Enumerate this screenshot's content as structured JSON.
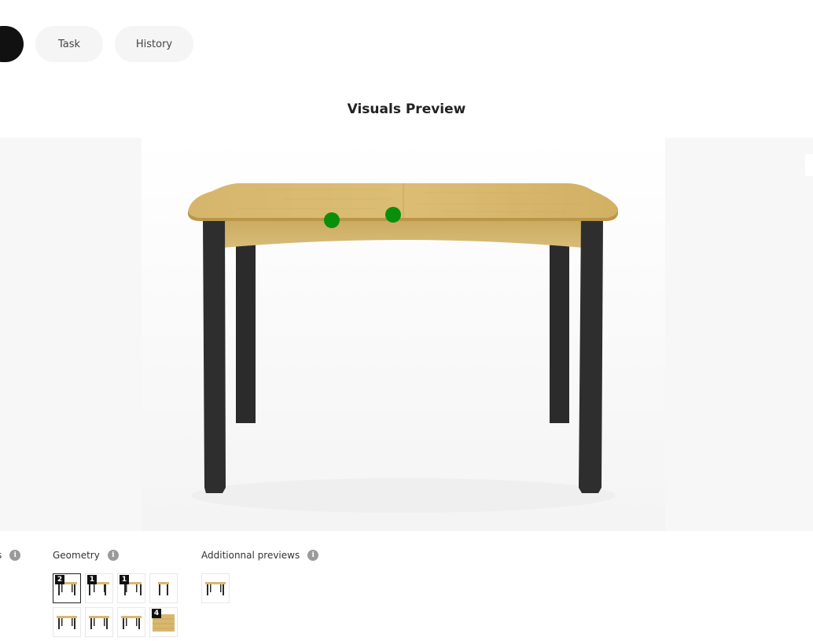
{
  "tabs": [
    {
      "label": "",
      "active": true
    },
    {
      "label": "Task",
      "active": false
    },
    {
      "label": "History",
      "active": false
    }
  ],
  "title": "Visuals Preview",
  "hotspots": [
    {
      "label": "",
      "color": "#0a8f0a"
    },
    {
      "label": "",
      "color": "#0a8f0a"
    }
  ],
  "sections": {
    "cut_label": "s",
    "geometry_label": "Geometry",
    "additional_label": "Additionnal previews",
    "info_icon": "info-icon"
  },
  "geometry_thumbs": [
    {
      "badge": "2",
      "selected": true,
      "view": "front"
    },
    {
      "badge": "1",
      "selected": false,
      "view": "angle-left"
    },
    {
      "badge": "1",
      "selected": false,
      "view": "angle-right"
    },
    {
      "badge": "",
      "selected": false,
      "view": "side"
    },
    {
      "badge": "",
      "selected": false,
      "view": "front"
    },
    {
      "badge": "",
      "selected": false,
      "view": "front"
    },
    {
      "badge": "",
      "selected": false,
      "view": "front"
    },
    {
      "badge": "4",
      "selected": false,
      "view": "wood-texture"
    }
  ],
  "additional_thumbs": [
    {
      "badge": "",
      "view": "front"
    }
  ],
  "colors": {
    "wood_light": "#d8b86e",
    "wood_dark": "#b89549",
    "legs": "#2b2b2b",
    "active_tab": "#111111",
    "hotspot": "#0a8f0a"
  }
}
